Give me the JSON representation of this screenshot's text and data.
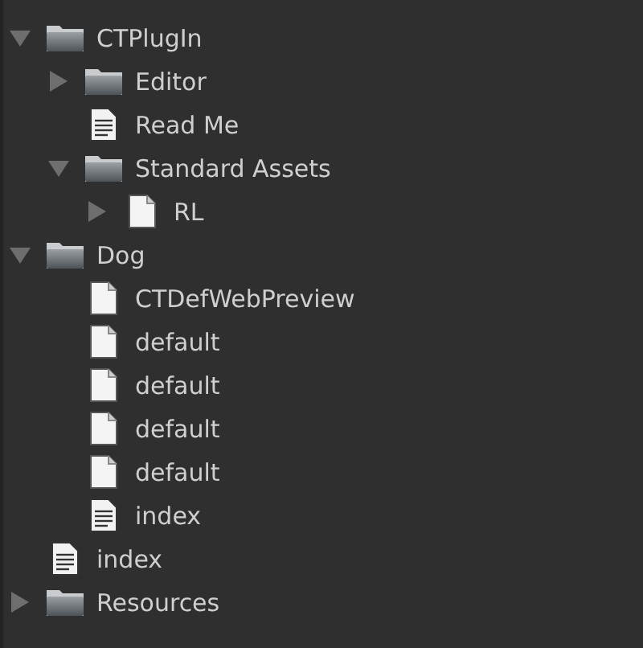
{
  "tree": [
    {
      "label": "CTPlugIn",
      "kind": "folder",
      "expanded": true,
      "children": [
        {
          "label": "Editor",
          "kind": "folder",
          "expanded": false
        },
        {
          "label": "Read Me",
          "kind": "document"
        },
        {
          "label": "Standard Assets",
          "kind": "folder",
          "expanded": true,
          "children": [
            {
              "label": "RL",
              "kind": "file",
              "expanded": false
            }
          ]
        }
      ]
    },
    {
      "label": "Dog",
      "kind": "folder",
      "expanded": true,
      "children": [
        {
          "label": "CTDefWebPreview",
          "kind": "file"
        },
        {
          "label": "default",
          "kind": "file"
        },
        {
          "label": "default",
          "kind": "file"
        },
        {
          "label": "default",
          "kind": "file"
        },
        {
          "label": "default",
          "kind": "file"
        },
        {
          "label": "index",
          "kind": "document"
        }
      ]
    },
    {
      "label": "index",
      "kind": "document"
    },
    {
      "label": "Resources",
      "kind": "folder",
      "expanded": false
    }
  ]
}
